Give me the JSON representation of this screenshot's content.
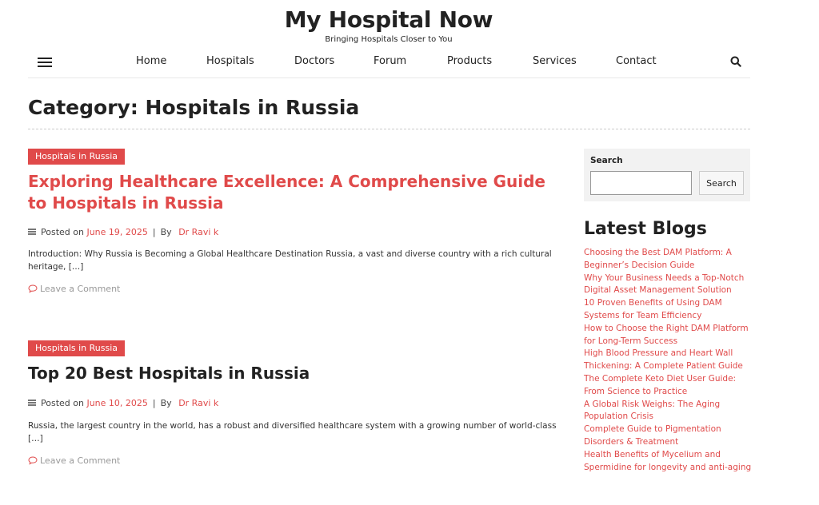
{
  "site": {
    "title": "My Hospital Now",
    "tagline": "Bringing Hospitals Closer to You"
  },
  "nav": {
    "menu_icon": "hamburger-menu-icon",
    "items": [
      {
        "label": "Home"
      },
      {
        "label": "Hospitals"
      },
      {
        "label": "Doctors"
      },
      {
        "label": "Forum"
      },
      {
        "label": "Products"
      },
      {
        "label": "Services"
      },
      {
        "label": "Contact"
      }
    ],
    "search_icon": "search-icon"
  },
  "page": {
    "title": "Category: Hospitals in Russia"
  },
  "posts": [
    {
      "category": "Hospitals in Russia",
      "title": "Exploring Healthcare Excellence: A Comprehensive Guide to Hospitals in Russia",
      "posted_prefix": "Posted on",
      "date": "June 19, 2025",
      "sep": "|",
      "by_prefix": "By",
      "author": "Dr Ravi k",
      "excerpt": "Introduction: Why Russia is Becoming a Global Healthcare Destination Russia, a vast and diverse country with a rich cultural heritage, […]",
      "comment_label": "Leave a Comment"
    },
    {
      "category": "Hospitals in Russia",
      "title": "Top 20 Best Hospitals in Russia",
      "posted_prefix": "Posted on",
      "date": "June 10, 2025",
      "sep": "|",
      "by_prefix": "By",
      "author": "Dr Ravi k",
      "excerpt": "Russia, the largest country in the world, has a robust and diversified healthcare system with a growing number of world-class […]",
      "comment_label": "Leave a Comment"
    }
  ],
  "sidebar": {
    "search": {
      "label": "Search",
      "input_value": "",
      "button_label": "Search"
    },
    "latest_blogs": {
      "heading": "Latest Blogs",
      "items": [
        "Choosing the Best DAM Platform: A Beginner’s Decision Guide",
        "Why Your Business Needs a Top-Notch Digital Asset Management Solution",
        "10 Proven Benefits of Using DAM Systems for Team Efficiency",
        "How to Choose the Right DAM Platform for Long-Term Success",
        "High Blood Pressure and Heart Wall Thickening: A Complete Patient Guide",
        "The Complete Keto Diet User Guide: From Science to Practice",
        "A Global Risk Weighs: The Aging Population Crisis",
        "Complete Guide to Pigmentation Disorders & Treatment",
        "Health Benefits of Mycelium and Spermidine for longevity and anti-aging"
      ]
    }
  },
  "colors": {
    "accent": "#e04a4a",
    "text": "#222222",
    "muted": "#999999"
  }
}
